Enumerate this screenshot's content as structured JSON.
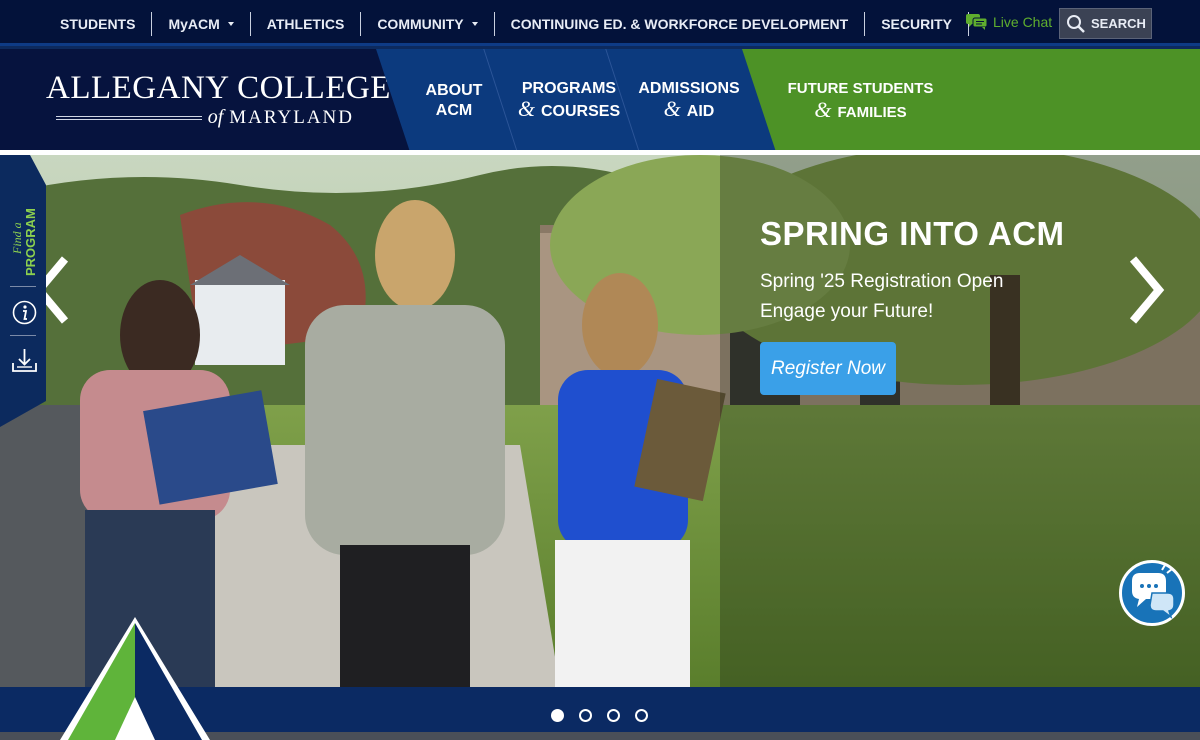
{
  "utility": {
    "items": [
      {
        "label": "STUDENTS",
        "dropdown": false
      },
      {
        "label": "MyACM",
        "dropdown": true
      },
      {
        "label": "ATHLETICS",
        "dropdown": false
      },
      {
        "label": "COMMUNITY",
        "dropdown": true
      },
      {
        "label": "CONTINUING ED. & WORKFORCE DEVELOPMENT",
        "dropdown": false
      },
      {
        "label": "SECURITY",
        "dropdown": false
      }
    ],
    "live_chat": "Live Chat",
    "search": "SEARCH",
    "icons": {
      "chat": "chat-icon",
      "search": "search-icon"
    }
  },
  "header": {
    "logo_line1": "ALLEGANY COLLEGE",
    "logo_of": "of",
    "logo_md": "MARYLAND",
    "nav": [
      {
        "line1": "ABOUT",
        "line2": "ACM",
        "amp": ""
      },
      {
        "line1": "PROGRAMS",
        "line2": "COURSES",
        "amp": "&"
      },
      {
        "line1": "ADMISSIONS",
        "line2": "AID",
        "amp": "&"
      }
    ],
    "future": {
      "line1": "FUTURE STUDENTS",
      "amp": "&",
      "line2": "FAMILIES"
    }
  },
  "side_tab": {
    "find_a": "Find a",
    "program": "PROGRAM",
    "icons": [
      "info-icon",
      "download-icon"
    ]
  },
  "hero": {
    "title": "SPRING INTO ACM",
    "sub1": "Spring '25 Registration Open",
    "sub2": "Engage your Future!",
    "cta": "Register Now",
    "slides": 4,
    "active_slide": 1
  },
  "colors": {
    "navy": "#06133e",
    "blue": "#0c3a7e",
    "green": "#4d9226",
    "cta": "#3aa0e8"
  }
}
